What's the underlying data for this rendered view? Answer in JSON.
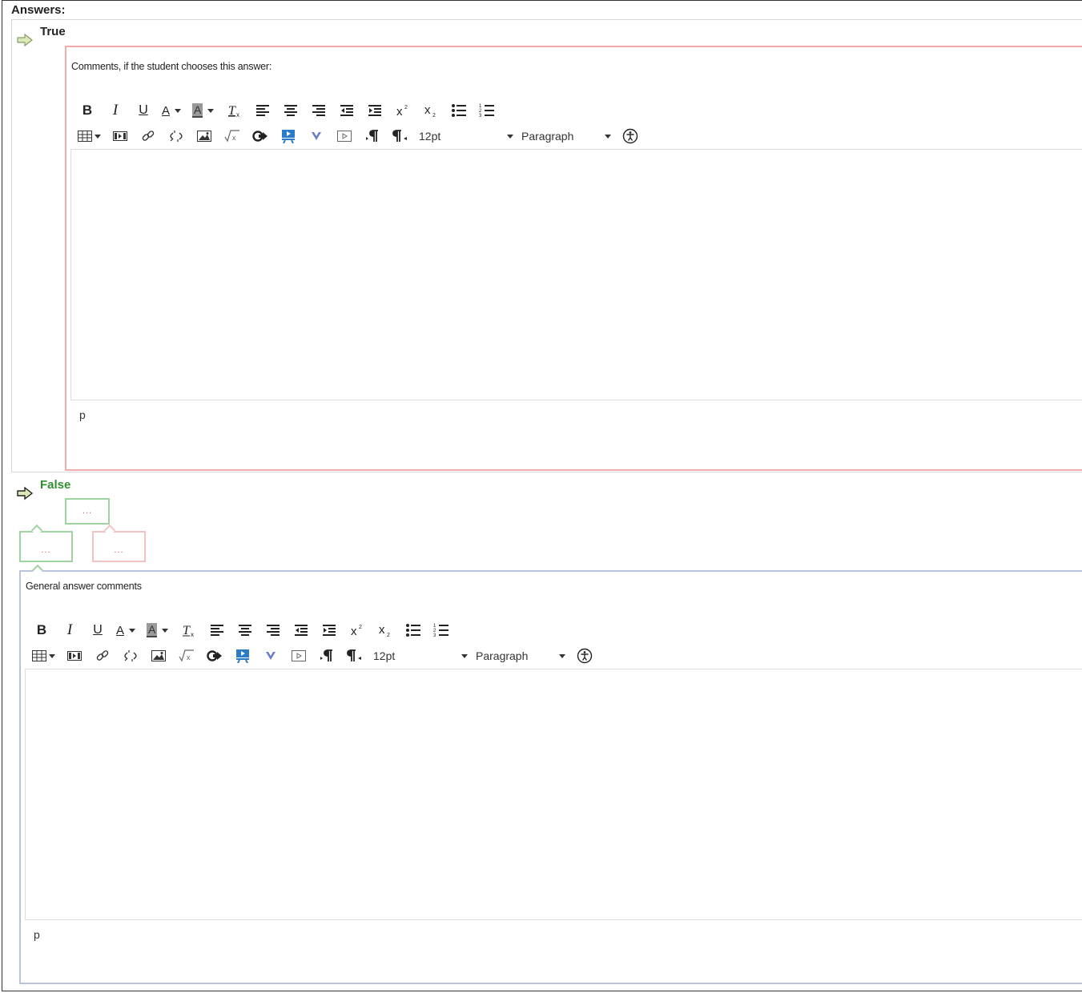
{
  "section": {
    "title": "Answers:"
  },
  "answers": [
    {
      "label": "True",
      "editor": {
        "caption": "Comments, if the student chooses this answer:",
        "font_size": "12pt",
        "block_format": "Paragraph",
        "status_path": "p",
        "border_color": "#f2aaaa"
      }
    },
    {
      "label": "False",
      "label_color": "#2f8f2f",
      "feedback_boxes": [
        {
          "text": "..."
        },
        {
          "text": "..."
        },
        {
          "text": "..."
        }
      ]
    }
  ],
  "general_editor": {
    "caption": "General answer comments",
    "font_size": "12pt",
    "block_format": "Paragraph",
    "status_path": "p",
    "border_color": "#b9c3dd"
  },
  "toolbar": {
    "row1": [
      "bold-icon",
      "italic-icon",
      "underline-icon",
      "text-color-icon",
      "background-color-icon",
      "clear-formatting-icon",
      "align-left-icon",
      "align-center-icon",
      "align-right-icon",
      "outdent-icon",
      "indent-icon",
      "superscript-icon",
      "subscript-icon",
      "bullet-list-icon",
      "numbered-list-icon"
    ],
    "row2": [
      "table-icon",
      "media-icon",
      "link-icon",
      "unlink-icon",
      "image-icon",
      "math-icon",
      "insert-icon",
      "presentation-icon",
      "dropdown-v-icon",
      "video-icon",
      "ltr-paragraph-icon",
      "rtl-paragraph-icon"
    ],
    "bold_label": "B",
    "italic_label": "I",
    "underline_label": "U",
    "text_color_label": "A",
    "bg_color_label": "A"
  }
}
